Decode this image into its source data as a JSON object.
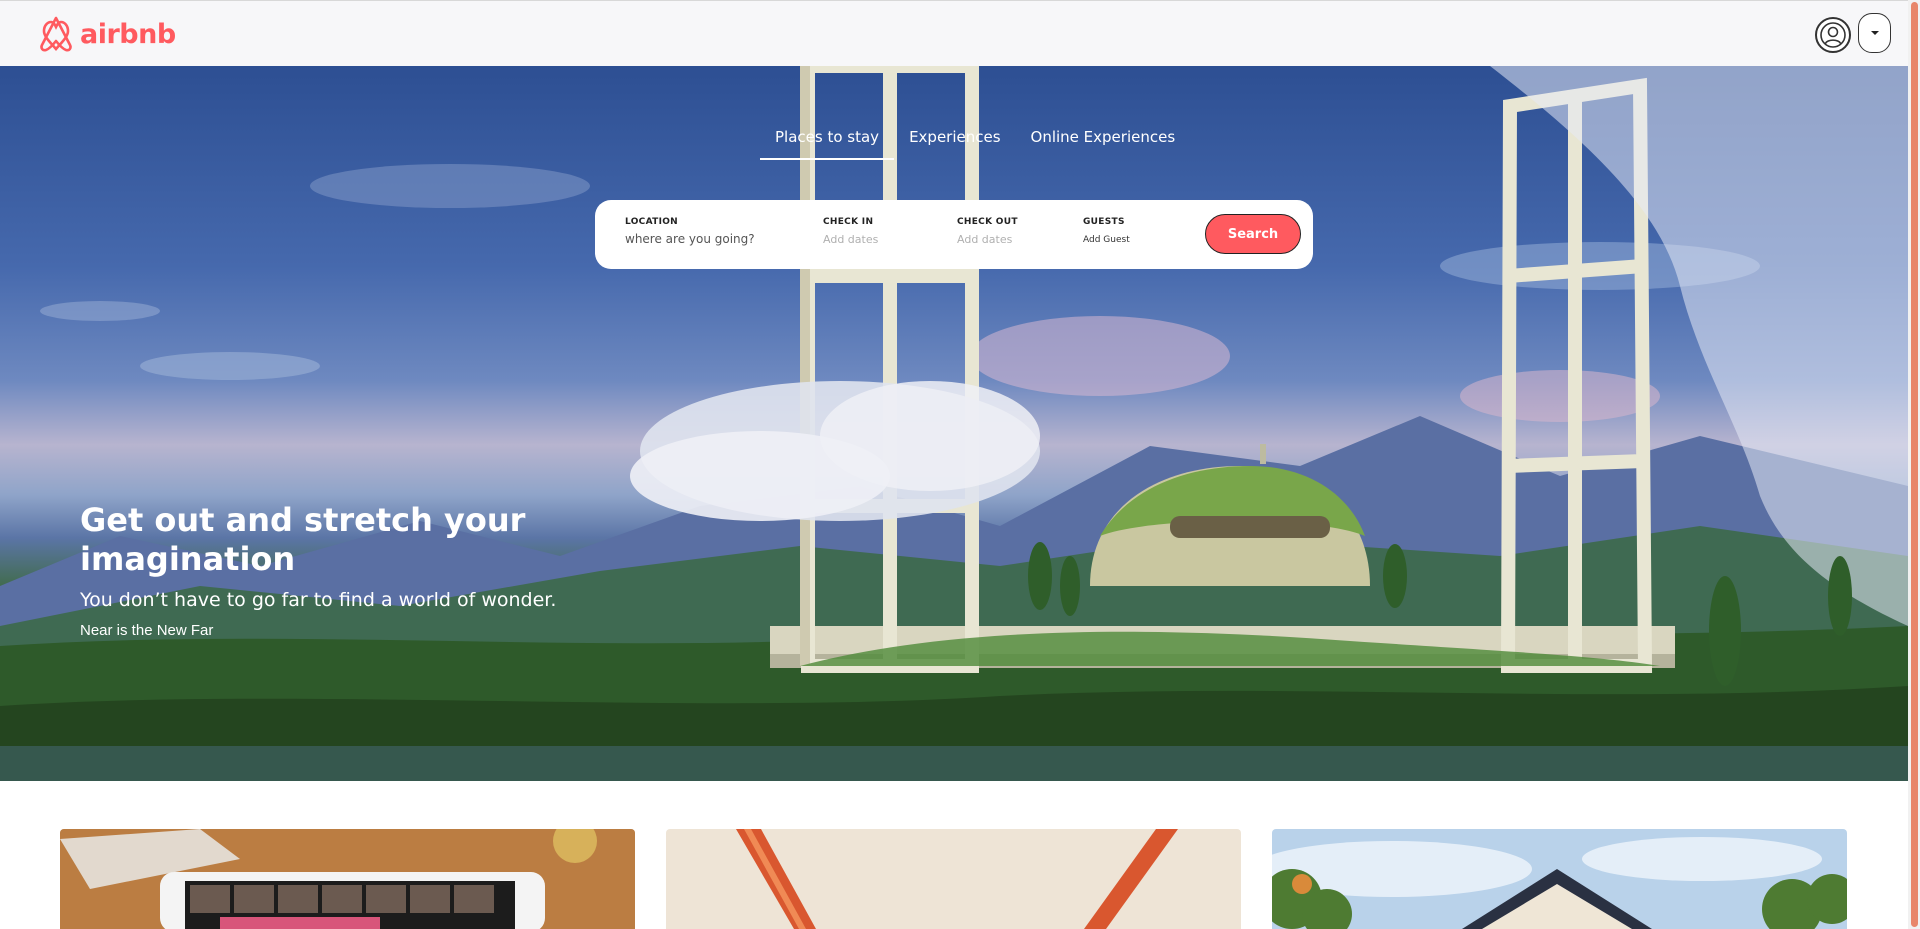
{
  "header": {
    "logo_text": "airbnb",
    "logo_icon": "airbnb-belo-icon",
    "profile_icon": "user-circle-icon",
    "menu_icon": "caret-down-icon"
  },
  "hero": {
    "tabs": [
      {
        "label": "Places to stay",
        "active": true
      },
      {
        "label": "Experiences",
        "active": false
      },
      {
        "label": "Online Experiences",
        "active": false
      }
    ],
    "search": {
      "location_label": "LOCATION",
      "location_placeholder": "where are you going?",
      "checkin_label": "CHECK IN",
      "checkin_value": "Add dates",
      "checkout_label": "CHECK OUT",
      "checkout_value": "Add dates",
      "guests_label": "GUESTS",
      "guests_value": "Add Guest",
      "button_label": "Search"
    },
    "title": "Get out and stretch your imagination",
    "subtitle": "You don’t have to go far to find a world of wonder.",
    "tagline": "Near is the New Far"
  },
  "colors": {
    "brand": "#ff5a5f",
    "header_bg": "#f7f7f9"
  },
  "cards": [
    {
      "image": "online-experience-video-call"
    },
    {
      "image": "hammock"
    },
    {
      "image": "cabin-house"
    }
  ]
}
